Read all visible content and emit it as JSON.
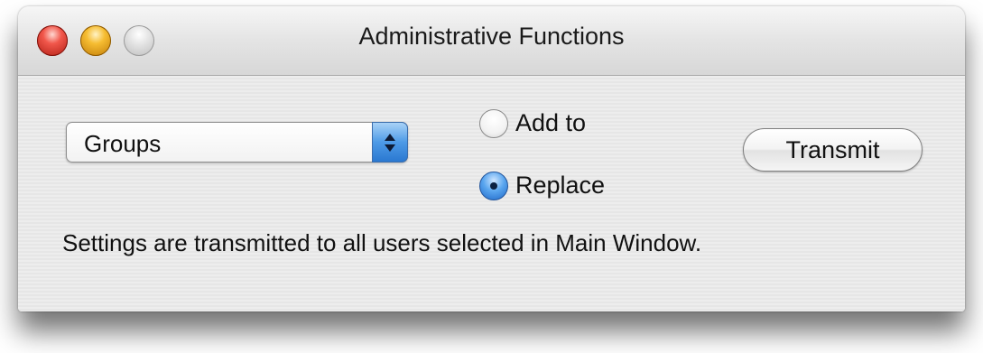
{
  "window": {
    "title": "Administrative Functions"
  },
  "popup": {
    "selected": "Groups"
  },
  "radio_group": {
    "options": [
      {
        "label": "Add to",
        "checked": false
      },
      {
        "label": "Replace",
        "checked": true
      }
    ]
  },
  "transmit_button": {
    "label": "Transmit"
  },
  "message": "Settings are transmitted to all users selected in Main Window.",
  "colors": {
    "close": "#f1574b",
    "minimize": "#f6bd32",
    "zoom": "#d9d9d9",
    "accent_blue": "#4d9ae6"
  },
  "icons": {
    "close": "close-icon",
    "minimize": "minimize-icon",
    "zoom": "zoom-icon",
    "popup_arrows": "chevron-updown-icon"
  }
}
